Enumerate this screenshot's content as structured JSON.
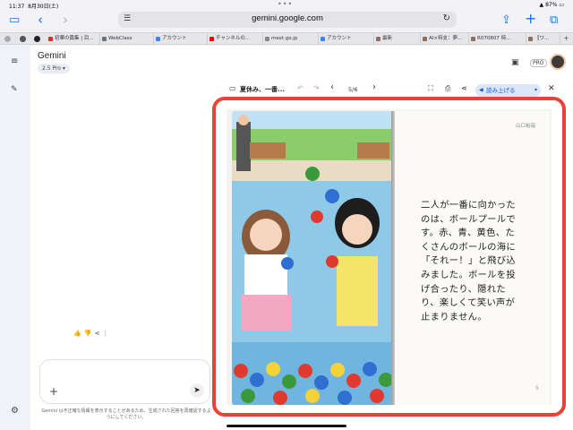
{
  "status": {
    "time": "11:37",
    "date": "8月30日(土)",
    "battery": "87%"
  },
  "browser": {
    "url": "gemini.google.com",
    "tabs": [
      {
        "label": "初華の篇集 | 目...",
        "color": "#d93025"
      },
      {
        "label": "WebClass",
        "color": "#6b7280"
      },
      {
        "label": "アカウント",
        "color": "#4285f4"
      },
      {
        "label": "チャンネルの...",
        "color": "#ff0000"
      },
      {
        "label": "mext.go.jp",
        "color": "#888888"
      },
      {
        "label": "アカウント",
        "color": "#4285f4"
      },
      {
        "label": "最新",
        "color": "#8d6e63"
      },
      {
        "label": "AI×特支：夢...",
        "color": "#8d6e63"
      },
      {
        "label": "R070807 特...",
        "color": "#8d6e63"
      },
      {
        "label": "【ワ...",
        "color": "#8d6e63"
      }
    ]
  },
  "gemini": {
    "title": "Gemini",
    "model": "2.5 Pro",
    "pro_badge": "PRO",
    "composer_plus": "+",
    "disclaimer": "Gemini は不正確な情報を表示することがあるため、生成された回答を再確認するようにしてください。"
  },
  "canvas": {
    "doc_title": "夏休み、一番...",
    "page_indicator": "5/6",
    "read_aloud": "読み上げる"
  },
  "book": {
    "author": "山口裕哉",
    "page_number": "5",
    "story_lines": [
      "二人が一番に向かった",
      "のは、ボールプールで",
      "す。赤、青、黄色、た",
      "くさんのボールの海に",
      "「それー！」と飛び込",
      "みました。ボールを投",
      "げ合ったり、隠れた",
      "り、楽しくて笑い声が",
      "止まりません。"
    ]
  },
  "colors": {
    "accent": "#1a73e8",
    "highlight": "#ea4335"
  }
}
